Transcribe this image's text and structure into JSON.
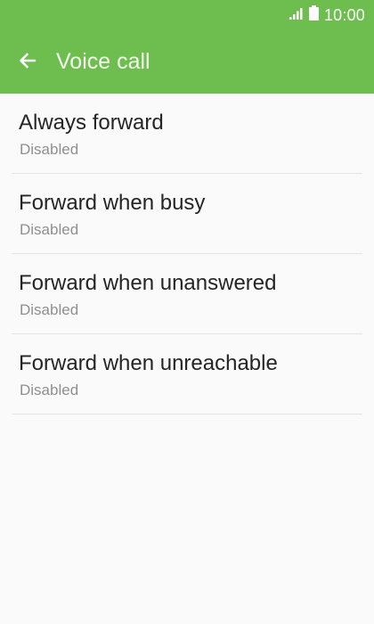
{
  "status_bar": {
    "time": "10:00",
    "signal_icon": "signal-icon",
    "battery_icon": "battery-icon"
  },
  "app_bar": {
    "back_icon": "back-arrow-icon",
    "title": "Voice call",
    "background": "#6dbd4f"
  },
  "items": [
    {
      "title": "Always forward",
      "summary": "Disabled"
    },
    {
      "title": "Forward when busy",
      "summary": "Disabled"
    },
    {
      "title": "Forward when unanswered",
      "summary": "Disabled"
    },
    {
      "title": "Forward when unreachable",
      "summary": "Disabled"
    }
  ]
}
